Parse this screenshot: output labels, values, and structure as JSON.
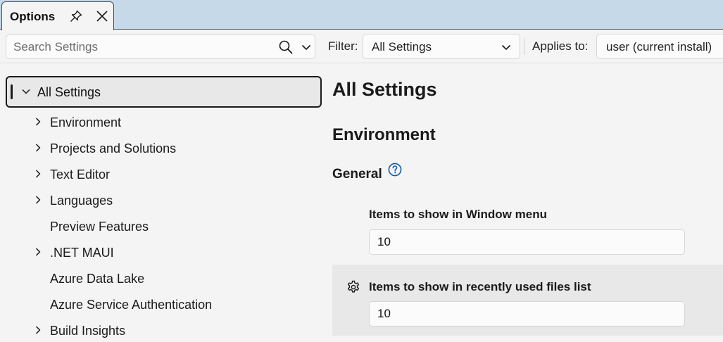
{
  "tab": {
    "title": "Options",
    "pin_icon": "pin-icon",
    "close_icon": "close-icon"
  },
  "toolbar": {
    "search_placeholder": "Search Settings",
    "filter_label": "Filter:",
    "filter_value": "All Settings",
    "applies_label": "Applies to:",
    "applies_value": "user (current install)"
  },
  "tree": {
    "selected": "All Settings",
    "items": [
      {
        "label": "Environment",
        "expandable": true
      },
      {
        "label": "Projects and Solutions",
        "expandable": true
      },
      {
        "label": "Text Editor",
        "expandable": true
      },
      {
        "label": "Languages",
        "expandable": true
      },
      {
        "label": "Preview Features",
        "expandable": false
      },
      {
        "label": ".NET MAUI",
        "expandable": true
      },
      {
        "label": "Azure Data Lake",
        "expandable": false
      },
      {
        "label": "Azure Service Authentication",
        "expandable": false
      },
      {
        "label": "Build Insights",
        "expandable": true
      }
    ]
  },
  "content": {
    "title": "All Settings",
    "section": "Environment",
    "subsection": "General",
    "settings": [
      {
        "label": "Items to show in Window menu",
        "value": "10"
      },
      {
        "label": "Items to show in recently used files list",
        "value": "10"
      }
    ]
  },
  "colors": {
    "tabstrip": "#c6d9e9",
    "background": "#f4f4f4",
    "selected": "#e8e8e8",
    "help_accent": "#0f5ba8"
  }
}
